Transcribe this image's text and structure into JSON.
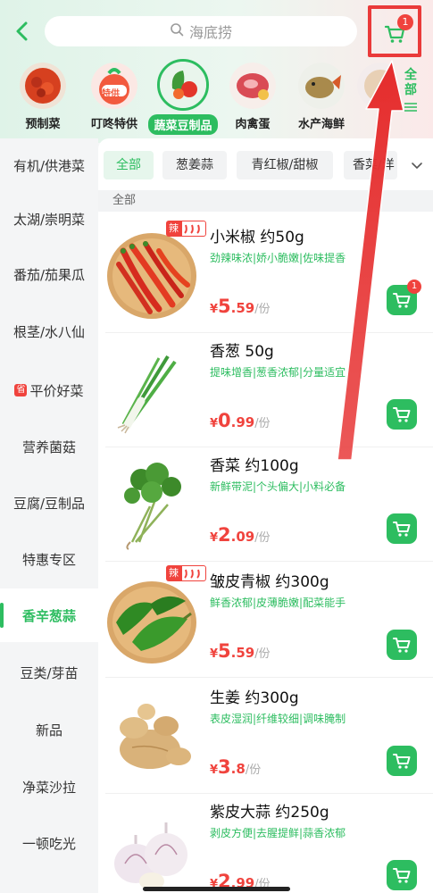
{
  "search": {
    "placeholder": "海底捞"
  },
  "cart": {
    "count": "1"
  },
  "categories": [
    {
      "label": "预制菜"
    },
    {
      "label": "叮咚特供",
      "tag": "特供"
    },
    {
      "label": "蔬菜豆制品",
      "active": true
    },
    {
      "label": "肉禽蛋"
    },
    {
      "label": "水产海鲜"
    }
  ],
  "all_categories": "全部",
  "sidebar": [
    {
      "label": "有机/供港菜"
    },
    {
      "label": "太湖/崇明菜"
    },
    {
      "label": "番茄/茄果瓜"
    },
    {
      "label": "根茎/水八仙"
    },
    {
      "label": "平价好菜",
      "tag": "省"
    },
    {
      "label": "营养菌菇"
    },
    {
      "label": "豆腐/豆制品"
    },
    {
      "label": "特惠专区"
    },
    {
      "label": "香辛葱蒜",
      "active": true
    },
    {
      "label": "豆类/芽苗"
    },
    {
      "label": "新品"
    },
    {
      "label": "净菜沙拉"
    },
    {
      "label": "一顿吃光"
    }
  ],
  "filters": [
    {
      "label": "全部",
      "active": true
    },
    {
      "label": "葱姜蒜"
    },
    {
      "label": "青红椒/甜椒"
    },
    {
      "label": "香菜/洋"
    }
  ],
  "section_title": "全部",
  "spicy_label": "辣",
  "price_currency": "¥",
  "products": [
    {
      "name": "小米椒 约50g",
      "desc": "劲辣味浓|娇小脆嫩|佐味提香",
      "price_int": "5",
      "price_dec": ".59",
      "unit": "/份",
      "spicy": true,
      "cart_badge": "1"
    },
    {
      "name": "香葱 50g",
      "desc": "提味增香|葱香浓郁|分量适宜",
      "price_int": "0",
      "price_dec": ".99",
      "unit": "/份"
    },
    {
      "name": "香菜 约100g",
      "desc": "新鲜带泥|个头偏大|小料必备",
      "price_int": "2",
      "price_dec": ".09",
      "unit": "/份"
    },
    {
      "name": "皱皮青椒 约300g",
      "desc": "鲜香浓郁|皮薄脆嫩|配菜能手",
      "price_int": "5",
      "price_dec": ".59",
      "unit": "/份",
      "spicy": true
    },
    {
      "name": "生姜 约300g",
      "desc": "表皮湿润|纤维较细|调味腌制",
      "price_int": "3",
      "price_dec": ".8",
      "unit": "/份"
    },
    {
      "name": "紫皮大蒜 约250g",
      "desc": "剥皮方便|去腥提鲜|蒜香浓郁",
      "price_int": "2",
      "price_dec": ".99",
      "unit": "/份"
    }
  ],
  "colors": {
    "brand_green": "#2dbd60",
    "price_red": "#f0433d",
    "annotation_red": "#ea3a3a"
  }
}
